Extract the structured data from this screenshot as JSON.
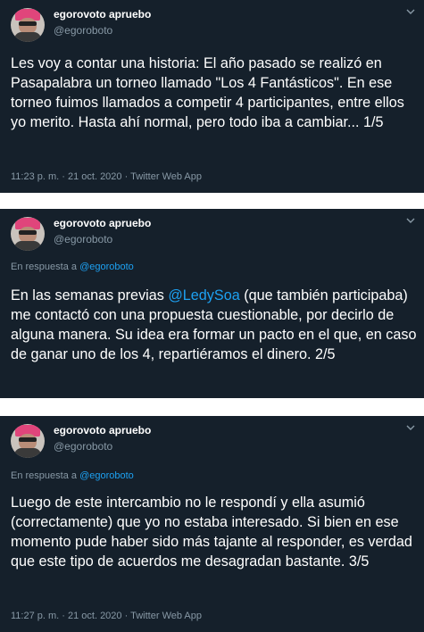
{
  "author": {
    "name": "egorovoto apruebo",
    "handle": "@egoroboto"
  },
  "reply_prefix": "En respuesta a",
  "reply_to": "@egoroboto",
  "tweets": [
    {
      "text": "Les voy a contar una historia: El año pasado se realizó en Pasapalabra un torneo llamado \"Los 4 Fantásticos\". En ese torneo fuimos llamados a competir 4 participantes, entre ellos yo merito. Hasta ahí normal, pero todo iba a cambiar... 1/5",
      "meta": "11:23 p. m. · 21 oct. 2020 · Twitter Web App"
    },
    {
      "text_before": "En las semanas previas ",
      "mention": "@LedySoa",
      "text_after": " (que también participaba) me contactó con una propuesta cuestionable, por decirlo de alguna manera. Su idea era formar un pacto en el que, en caso de ganar uno de los 4, repartiéramos el dinero. 2/5"
    },
    {
      "text": "Luego de este intercambio no le respondí y ella asumió (correctamente) que yo no estaba interesado. Si bien en ese momento pude haber sido más tajante al responder, es verdad que este tipo de acuerdos me desagradan bastante. 3/5",
      "meta": "11:27 p. m. · 21 oct. 2020 · Twitter Web App"
    }
  ],
  "colors": {
    "background": "#15202b",
    "text": "#ffffff",
    "secondary": "#8899a6",
    "link": "#1da1f2"
  },
  "icons": [
    "avatar",
    "chevron-down-icon"
  ]
}
